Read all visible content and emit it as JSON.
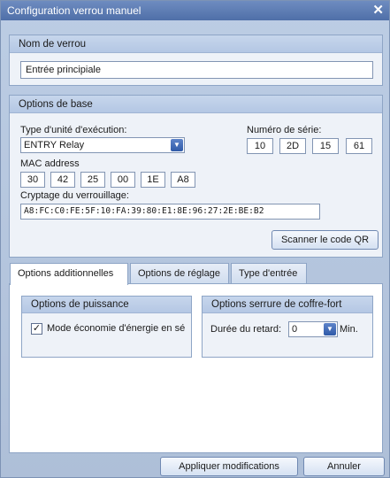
{
  "window": {
    "title": "Configuration verrou manuel",
    "close_glyph": "✕"
  },
  "lock_name": {
    "header": "Nom de verrou",
    "value": "Entrée principiale"
  },
  "base": {
    "header": "Options de base",
    "unit_type_label": "Type d'unité d'exécution:",
    "unit_type_value": "ENTRY Relay",
    "serial_label": "Numéro de série:",
    "serial": [
      "10",
      "2D",
      "15",
      "61"
    ],
    "mac_label": "MAC address",
    "mac": [
      "30",
      "42",
      "25",
      "00",
      "1E",
      "A8"
    ],
    "crypto_label": "Cryptage du verrouillage:",
    "crypto_value": "A8:FC:C0:FE:5F:10:FA:39:80:E1:8E:96:27:2E:BE:B2",
    "scan_button": "Scanner le code QR"
  },
  "tabs": [
    "Options additionnelles",
    "Options de réglage",
    "Type d'entrée"
  ],
  "power": {
    "header": "Options de puissance",
    "eco_label": "Mode économie d'énergie en sé",
    "eco_checked": "✓"
  },
  "safe": {
    "header": "Options serrure de coffre-fort",
    "delay_label": "Durée du retard:",
    "delay_value": "0",
    "unit": "Min."
  },
  "footer": {
    "apply": "Appliquer modifications",
    "cancel": "Annuler"
  }
}
